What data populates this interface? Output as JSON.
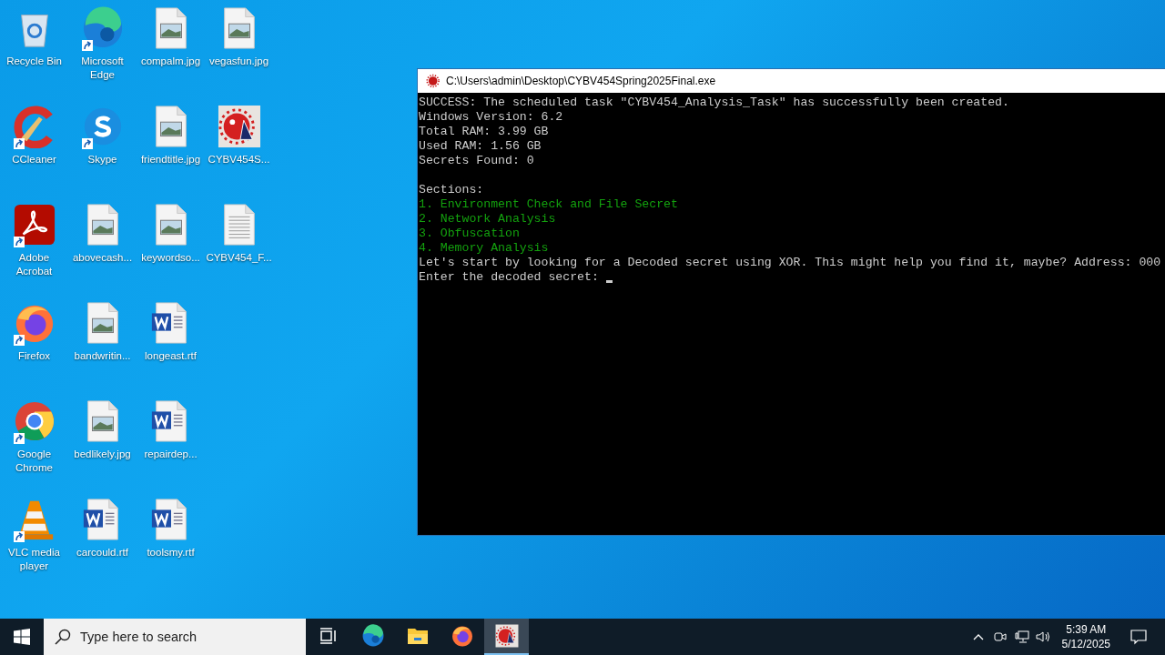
{
  "desktop_icons": [
    {
      "label": "Recycle Bin",
      "kind": "recycle",
      "shortcut": false
    },
    {
      "label": "CCleaner",
      "kind": "ccleaner",
      "shortcut": true
    },
    {
      "label": "Adobe Acrobat",
      "kind": "pdf",
      "shortcut": true
    },
    {
      "label": "Firefox",
      "kind": "firefox",
      "shortcut": true
    },
    {
      "label": "Google Chrome",
      "kind": "chrome",
      "shortcut": true
    },
    {
      "label": "VLC media player",
      "kind": "vlc",
      "shortcut": true
    },
    {
      "label": "Microsoft Edge",
      "kind": "edge",
      "shortcut": true
    },
    {
      "label": "Skype",
      "kind": "skype",
      "shortcut": true
    },
    {
      "label": "abovecash...",
      "kind": "image",
      "shortcut": false
    },
    {
      "label": "bandwritin...",
      "kind": "image",
      "shortcut": false
    },
    {
      "label": "bedlikely.jpg",
      "kind": "image",
      "shortcut": false
    },
    {
      "label": "carcould.rtf",
      "kind": "word",
      "shortcut": false
    },
    {
      "label": "compalm.jpg",
      "kind": "image",
      "shortcut": false
    },
    {
      "label": "friendtitle.jpg",
      "kind": "image",
      "shortcut": false
    },
    {
      "label": "keywordso...",
      "kind": "image",
      "shortcut": false
    },
    {
      "label": "longeast.rtf",
      "kind": "word",
      "shortcut": false
    },
    {
      "label": "repairdep...",
      "kind": "word",
      "shortcut": false
    },
    {
      "label": "toolsmy.rtf",
      "kind": "word",
      "shortcut": false
    },
    {
      "label": "vegasfun.jpg",
      "kind": "image",
      "shortcut": false
    },
    {
      "label": "CYBV454S...",
      "kind": "app",
      "shortcut": false
    },
    {
      "label": "CYBV454_F...",
      "kind": "text",
      "shortcut": false
    }
  ],
  "console": {
    "title": "C:\\Users\\admin\\Desktop\\CYBV454Spring2025Final.exe",
    "lines": [
      {
        "text": "SUCCESS: The scheduled task \"CYBV454_Analysis_Task\" has successfully been created.",
        "kind": "plain"
      },
      {
        "text": "Windows Version: 6.2",
        "kind": "plain"
      },
      {
        "text": "Total RAM: 3.99 GB",
        "kind": "plain"
      },
      {
        "text": "Used RAM: 1.56 GB",
        "kind": "plain"
      },
      {
        "text": "Secrets Found: 0",
        "kind": "plain"
      },
      {
        "kind": "blank"
      },
      {
        "text": "Sections:",
        "kind": "plain"
      },
      {
        "text": "1. Environment Check and File Secret",
        "kind": "section"
      },
      {
        "text": "2. Network Analysis",
        "kind": "section"
      },
      {
        "text": "3. Obfuscation",
        "kind": "section"
      },
      {
        "text": "4. Memory Analysis",
        "kind": "section"
      },
      {
        "text": "Let's start by looking for a Decoded secret using XOR. This might help you find it, maybe? Address: 000",
        "kind": "plain"
      },
      {
        "text": "Enter the decoded secret: ",
        "kind": "prompt"
      }
    ]
  },
  "taskbar": {
    "search": {
      "placeholder": "Type here to search"
    },
    "pinned": [
      {
        "kind": "taskview",
        "selected": false
      },
      {
        "kind": "edge",
        "selected": false
      },
      {
        "kind": "explorer",
        "selected": false
      },
      {
        "kind": "firefox",
        "selected": false
      },
      {
        "kind": "app",
        "selected": true
      }
    ],
    "clock": {
      "time": "5:39 AM",
      "date": "5/12/2025"
    }
  }
}
